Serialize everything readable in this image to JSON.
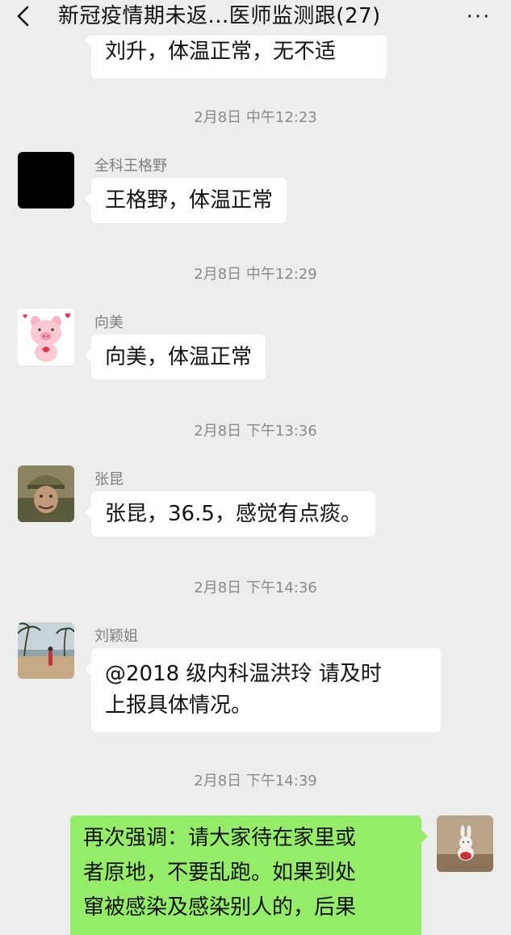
{
  "header": {
    "title": "新冠疫情期未返...医师监测跟(27)",
    "back_icon": "chevron-left-icon",
    "more_icon": "more-dots-icon",
    "more_label": "···"
  },
  "messages": [
    {
      "type": "text",
      "text": "刘升，体温正常，无不适"
    },
    {
      "type": "time",
      "text": "2月8日 中午12:23"
    },
    {
      "type": "text",
      "sender": "全科王格野",
      "text": "王格野，体温正常",
      "avatar": "black-square-avatar"
    },
    {
      "type": "time",
      "text": "2月8日 中午12:29"
    },
    {
      "type": "text",
      "sender": "向美",
      "text": "向美，体温正常",
      "avatar": "pig-cartoon-avatar"
    },
    {
      "type": "time",
      "text": "2月8日 下午13:36"
    },
    {
      "type": "text",
      "sender": "张昆",
      "text": "张昆，36.5，感觉有点痰。",
      "avatar": "soldier-photo-avatar"
    },
    {
      "type": "time",
      "text": "2月8日 下午14:36"
    },
    {
      "type": "text",
      "sender": "刘颖姐",
      "lines": [
        "@2018 级内科温洪玲  请及时",
        "上报具体情况。"
      ],
      "avatar": "beach-photo-avatar"
    },
    {
      "type": "time",
      "text": "2月8日 下午14:39"
    },
    {
      "type": "text",
      "mine": true,
      "lines": [
        "再次强调：请大家待在家里或",
        "者原地，不要乱跑。如果到处",
        "窜被感染及感染别人的，后果"
      ],
      "avatar": "bunny-photo-avatar"
    }
  ],
  "colors": {
    "background": "#ededed",
    "bubble_incoming": "#ffffff",
    "bubble_outgoing": "#95ec69",
    "time_text": "#8a8a8a",
    "sender_text": "#7f7f7f"
  }
}
